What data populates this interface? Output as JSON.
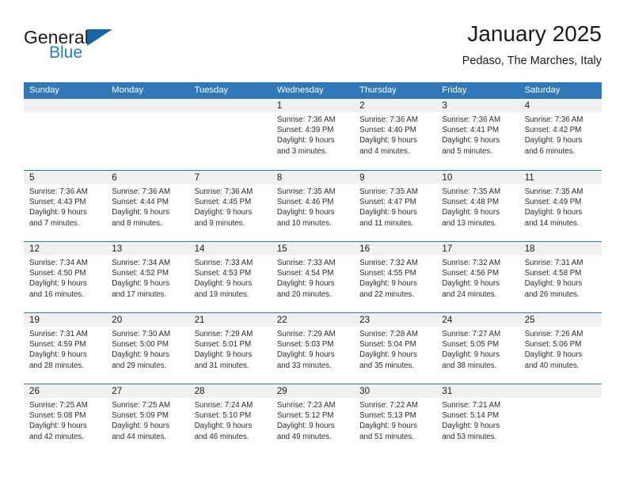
{
  "brand": {
    "name_top": "General",
    "name_bottom": "Blue",
    "colors": {
      "text": "#1b1b1b",
      "blue": "#1e7fc4",
      "triangle": "#1565a8"
    }
  },
  "header": {
    "title": "January 2025",
    "subtitle": "Pedaso, The Marches, Italy"
  },
  "calendar": {
    "accent_color": "#3178b8",
    "day_band_color": "#f0f0f0",
    "weekdays": [
      "Sunday",
      "Monday",
      "Tuesday",
      "Wednesday",
      "Thursday",
      "Friday",
      "Saturday"
    ],
    "weeks": [
      [
        {
          "day": "",
          "empty": true,
          "lines": [
            "",
            "",
            "",
            ""
          ]
        },
        {
          "day": "",
          "empty": true,
          "lines": [
            "",
            "",
            "",
            ""
          ]
        },
        {
          "day": "",
          "empty": true,
          "lines": [
            "",
            "",
            "",
            ""
          ]
        },
        {
          "day": "1",
          "lines": [
            "Sunrise: 7:36 AM",
            "Sunset: 4:39 PM",
            "Daylight: 9 hours",
            "and 3 minutes."
          ]
        },
        {
          "day": "2",
          "lines": [
            "Sunrise: 7:36 AM",
            "Sunset: 4:40 PM",
            "Daylight: 9 hours",
            "and 4 minutes."
          ]
        },
        {
          "day": "3",
          "lines": [
            "Sunrise: 7:36 AM",
            "Sunset: 4:41 PM",
            "Daylight: 9 hours",
            "and 5 minutes."
          ]
        },
        {
          "day": "4",
          "lines": [
            "Sunrise: 7:36 AM",
            "Sunset: 4:42 PM",
            "Daylight: 9 hours",
            "and 6 minutes."
          ]
        }
      ],
      [
        {
          "day": "5",
          "lines": [
            "Sunrise: 7:36 AM",
            "Sunset: 4:43 PM",
            "Daylight: 9 hours",
            "and 7 minutes."
          ]
        },
        {
          "day": "6",
          "lines": [
            "Sunrise: 7:36 AM",
            "Sunset: 4:44 PM",
            "Daylight: 9 hours",
            "and 8 minutes."
          ]
        },
        {
          "day": "7",
          "lines": [
            "Sunrise: 7:36 AM",
            "Sunset: 4:45 PM",
            "Daylight: 9 hours",
            "and 9 minutes."
          ]
        },
        {
          "day": "8",
          "lines": [
            "Sunrise: 7:35 AM",
            "Sunset: 4:46 PM",
            "Daylight: 9 hours",
            "and 10 minutes."
          ]
        },
        {
          "day": "9",
          "lines": [
            "Sunrise: 7:35 AM",
            "Sunset: 4:47 PM",
            "Daylight: 9 hours",
            "and 11 minutes."
          ]
        },
        {
          "day": "10",
          "lines": [
            "Sunrise: 7:35 AM",
            "Sunset: 4:48 PM",
            "Daylight: 9 hours",
            "and 13 minutes."
          ]
        },
        {
          "day": "11",
          "lines": [
            "Sunrise: 7:35 AM",
            "Sunset: 4:49 PM",
            "Daylight: 9 hours",
            "and 14 minutes."
          ]
        }
      ],
      [
        {
          "day": "12",
          "lines": [
            "Sunrise: 7:34 AM",
            "Sunset: 4:50 PM",
            "Daylight: 9 hours",
            "and 16 minutes."
          ]
        },
        {
          "day": "13",
          "lines": [
            "Sunrise: 7:34 AM",
            "Sunset: 4:52 PM",
            "Daylight: 9 hours",
            "and 17 minutes."
          ]
        },
        {
          "day": "14",
          "lines": [
            "Sunrise: 7:33 AM",
            "Sunset: 4:53 PM",
            "Daylight: 9 hours",
            "and 19 minutes."
          ]
        },
        {
          "day": "15",
          "lines": [
            "Sunrise: 7:33 AM",
            "Sunset: 4:54 PM",
            "Daylight: 9 hours",
            "and 20 minutes."
          ]
        },
        {
          "day": "16",
          "lines": [
            "Sunrise: 7:32 AM",
            "Sunset: 4:55 PM",
            "Daylight: 9 hours",
            "and 22 minutes."
          ]
        },
        {
          "day": "17",
          "lines": [
            "Sunrise: 7:32 AM",
            "Sunset: 4:56 PM",
            "Daylight: 9 hours",
            "and 24 minutes."
          ]
        },
        {
          "day": "18",
          "lines": [
            "Sunrise: 7:31 AM",
            "Sunset: 4:58 PM",
            "Daylight: 9 hours",
            "and 26 minutes."
          ]
        }
      ],
      [
        {
          "day": "19",
          "lines": [
            "Sunrise: 7:31 AM",
            "Sunset: 4:59 PM",
            "Daylight: 9 hours",
            "and 28 minutes."
          ]
        },
        {
          "day": "20",
          "lines": [
            "Sunrise: 7:30 AM",
            "Sunset: 5:00 PM",
            "Daylight: 9 hours",
            "and 29 minutes."
          ]
        },
        {
          "day": "21",
          "lines": [
            "Sunrise: 7:29 AM",
            "Sunset: 5:01 PM",
            "Daylight: 9 hours",
            "and 31 minutes."
          ]
        },
        {
          "day": "22",
          "lines": [
            "Sunrise: 7:29 AM",
            "Sunset: 5:03 PM",
            "Daylight: 9 hours",
            "and 33 minutes."
          ]
        },
        {
          "day": "23",
          "lines": [
            "Sunrise: 7:28 AM",
            "Sunset: 5:04 PM",
            "Daylight: 9 hours",
            "and 35 minutes."
          ]
        },
        {
          "day": "24",
          "lines": [
            "Sunrise: 7:27 AM",
            "Sunset: 5:05 PM",
            "Daylight: 9 hours",
            "and 38 minutes."
          ]
        },
        {
          "day": "25",
          "lines": [
            "Sunrise: 7:26 AM",
            "Sunset: 5:06 PM",
            "Daylight: 9 hours",
            "and 40 minutes."
          ]
        }
      ],
      [
        {
          "day": "26",
          "lines": [
            "Sunrise: 7:25 AM",
            "Sunset: 5:08 PM",
            "Daylight: 9 hours",
            "and 42 minutes."
          ]
        },
        {
          "day": "27",
          "lines": [
            "Sunrise: 7:25 AM",
            "Sunset: 5:09 PM",
            "Daylight: 9 hours",
            "and 44 minutes."
          ]
        },
        {
          "day": "28",
          "lines": [
            "Sunrise: 7:24 AM",
            "Sunset: 5:10 PM",
            "Daylight: 9 hours",
            "and 46 minutes."
          ]
        },
        {
          "day": "29",
          "lines": [
            "Sunrise: 7:23 AM",
            "Sunset: 5:12 PM",
            "Daylight: 9 hours",
            "and 49 minutes."
          ]
        },
        {
          "day": "30",
          "lines": [
            "Sunrise: 7:22 AM",
            "Sunset: 5:13 PM",
            "Daylight: 9 hours",
            "and 51 minutes."
          ]
        },
        {
          "day": "31",
          "lines": [
            "Sunrise: 7:21 AM",
            "Sunset: 5:14 PM",
            "Daylight: 9 hours",
            "and 53 minutes."
          ]
        },
        {
          "day": "",
          "empty": true,
          "lines": [
            "",
            "",
            "",
            ""
          ]
        }
      ]
    ]
  }
}
